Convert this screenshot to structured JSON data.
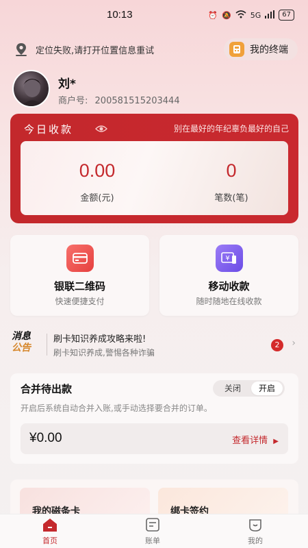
{
  "status": {
    "time": "10:13",
    "battery": "67",
    "network": "5G"
  },
  "location": {
    "message": "定位失败,请打开位置信息重试",
    "terminal_label": "我的终端"
  },
  "profile": {
    "name": "刘*",
    "merchant_label": "商户号:",
    "merchant_id": "200581515203444"
  },
  "income": {
    "title": "今日收款",
    "slogan": "别在最好的年纪辜负最好的自己",
    "amount": "0.00",
    "amount_label": "金额(元)",
    "count": "0",
    "count_label": "笔数(笔)"
  },
  "services": [
    {
      "title": "银联二维码",
      "subtitle": "快速便捷支付",
      "icon": "card-icon",
      "color": "#ee4d4b"
    },
    {
      "title": "移动收款",
      "subtitle": "随时随地在线收款",
      "icon": "yuan-icon",
      "color": "#7a5cf0"
    }
  ],
  "notice": {
    "logo_line1": "消息",
    "logo_line2": "公告",
    "title": "刷卡知识养成攻略来啦!",
    "subtitle": "刷卡知识养成,警惕各种诈骗",
    "badge": "2"
  },
  "merge": {
    "title": "合并待出款",
    "toggle_off": "关闭",
    "toggle_on": "开启",
    "description": "开启后系统自动合并入账,或手动选择要合并的订单。",
    "amount": "¥0.00",
    "detail_label": "查看详情"
  },
  "cards": [
    {
      "title": "我的磁条卡"
    },
    {
      "title": "绑卡签约"
    }
  ],
  "tabs": [
    {
      "label": "首页",
      "icon": "home-icon",
      "active": true
    },
    {
      "label": "账单",
      "icon": "bill-icon",
      "active": false
    },
    {
      "label": "我的",
      "icon": "profile-icon",
      "active": false
    }
  ],
  "colors": {
    "brand_red": "#c4292d",
    "accent_orange": "#f0a13a"
  }
}
